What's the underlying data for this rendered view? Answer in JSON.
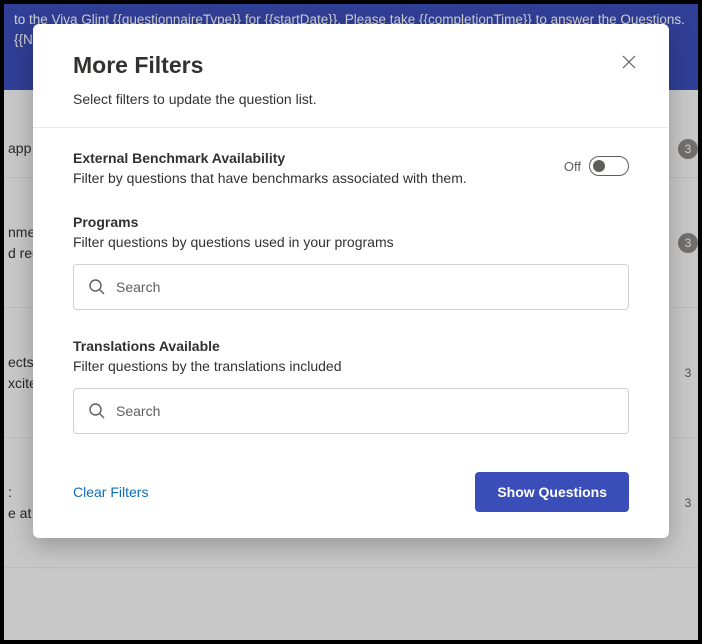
{
  "banner": {
    "text": "to the Viva Glint {{questionnaireType}} for {{startDate}}. Please take {{completionTime}} to answer the Questions.                                                                                                                                                                                                    {{Name}} r tak"
  },
  "bg_rows": [
    {
      "text": "app",
      "badge": "3"
    },
    {
      "text": "nme\nd rec",
      "badge": "3"
    },
    {
      "text": "ects\nxcite",
      "badge": "3"
    },
    {
      "text": ":\ne at",
      "badge": "3"
    }
  ],
  "modal": {
    "title": "More Filters",
    "subtitle": "Select filters to update the question list.",
    "filter_benchmark": {
      "title": "External Benchmark Availability",
      "desc": "Filter by questions that have benchmarks associated with them.",
      "toggle_label": "Off"
    },
    "filter_programs": {
      "title": "Programs",
      "desc": "Filter questions by questions used in your programs",
      "placeholder": "Search"
    },
    "filter_translations": {
      "title": "Translations Available",
      "desc": "Filter questions by the translations included",
      "placeholder": "Search"
    },
    "footer": {
      "clear": "Clear Filters",
      "apply": "Show Questions"
    }
  }
}
